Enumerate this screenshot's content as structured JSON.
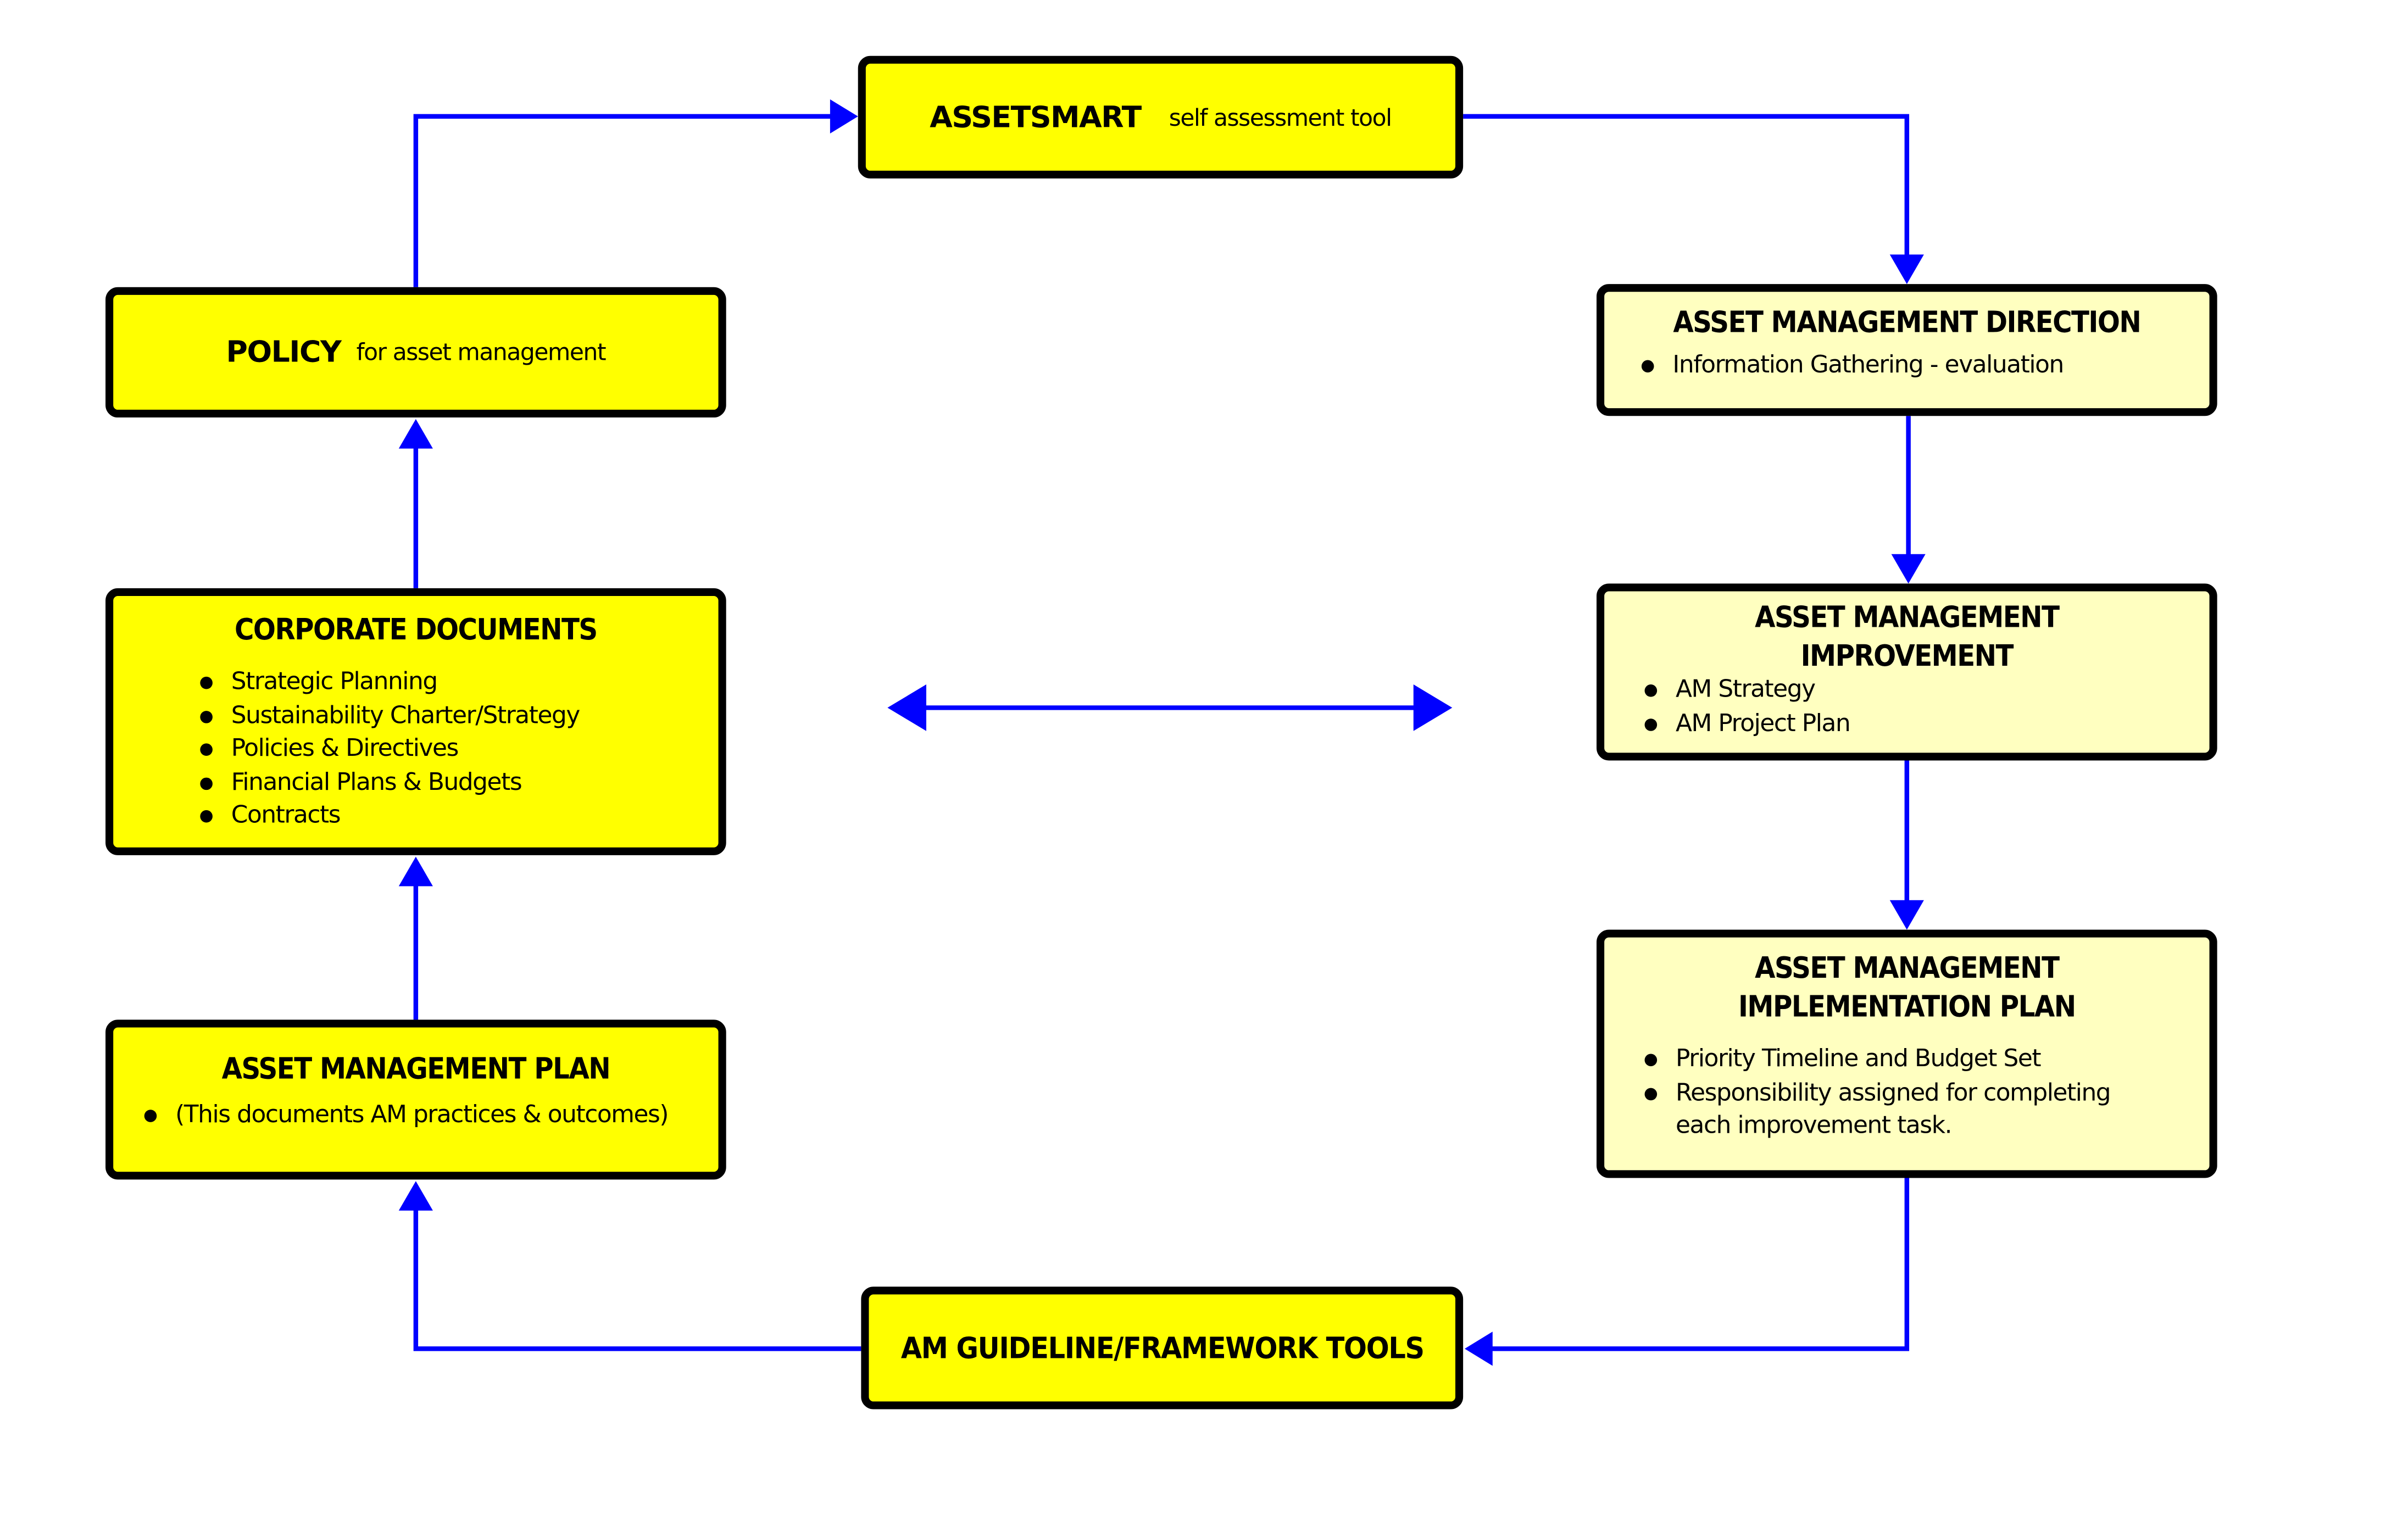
{
  "colors": {
    "box_fill_primary": "#ffff00",
    "box_fill_secondary": "#ffffc0",
    "box_border": "#000000",
    "connector": "#0000ff"
  },
  "nodes": {
    "assetsmart": {
      "title": "ASSETSMART",
      "subtitle": "self assessment tool"
    },
    "policy": {
      "title": "POLICY",
      "subtitle": "for asset management"
    },
    "corporate_documents": {
      "title": "CORPORATE DOCUMENTS",
      "items": [
        "Strategic Planning",
        "Sustainability Charter/Strategy",
        "Policies & Directives",
        "Financial Plans & Budgets",
        "Contracts"
      ]
    },
    "asset_management_plan": {
      "title": "ASSET MANAGEMENT PLAN",
      "items": [
        "(This documents AM practices & outcomes)"
      ]
    },
    "am_guideline": {
      "title": "AM GUIDELINE/FRAMEWORK TOOLS"
    },
    "am_direction": {
      "title": "ASSET MANAGEMENT DIRECTION",
      "items": [
        "Information Gathering - evaluation"
      ]
    },
    "am_improvement": {
      "title_line1": "ASSET MANAGEMENT",
      "title_line2": "IMPROVEMENT",
      "items": [
        "AM Strategy",
        "AM Project Plan"
      ]
    },
    "am_implementation": {
      "title_line1": "ASSET MANAGEMENT",
      "title_line2": "IMPLEMENTATION PLAN",
      "items": [
        "Priority Timeline and Budget Set",
        "Responsibility assigned for completing each improvement task."
      ]
    }
  },
  "edges": [
    {
      "from": "policy",
      "to": "assetsmart"
    },
    {
      "from": "assetsmart",
      "to": "am_direction"
    },
    {
      "from": "am_direction",
      "to": "am_improvement"
    },
    {
      "from": "am_improvement",
      "to": "am_implementation"
    },
    {
      "from": "am_implementation",
      "to": "am_guideline"
    },
    {
      "from": "am_guideline",
      "to": "asset_management_plan"
    },
    {
      "from": "asset_management_plan",
      "to": "corporate_documents"
    },
    {
      "from": "corporate_documents",
      "to": "policy"
    },
    {
      "from": "left-column",
      "to": "right-column",
      "bidirectional": true
    }
  ]
}
